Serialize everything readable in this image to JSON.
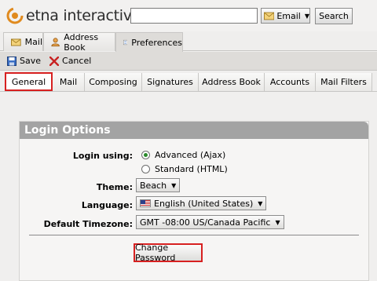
{
  "header": {
    "logo_text": "etna interactive",
    "search": {
      "value": "",
      "placeholder": ""
    },
    "email_dropdown": {
      "label": "Email",
      "icon": "envelope-icon"
    },
    "search_button": "Search"
  },
  "top_tabs": [
    {
      "label": "Mail",
      "icon": "envelope-icon",
      "active": false
    },
    {
      "label": "Address Book",
      "icon": "contacts-icon",
      "active": false
    },
    {
      "label": "Preferences",
      "icon": "preferences-icon",
      "active": true
    }
  ],
  "toolbar": {
    "save": "Save",
    "cancel": "Cancel"
  },
  "sub_tabs": [
    {
      "label": "General",
      "active": true
    },
    {
      "label": "Mail",
      "active": false
    },
    {
      "label": "Composing",
      "active": false
    },
    {
      "label": "Signatures",
      "active": false
    },
    {
      "label": "Address Book",
      "active": false
    },
    {
      "label": "Accounts",
      "active": false
    },
    {
      "label": "Mail Filters",
      "active": false
    }
  ],
  "login_options": {
    "title": "Login Options",
    "login_using_label": "Login using:",
    "login_options": [
      {
        "label": "Advanced (Ajax)",
        "selected": true
      },
      {
        "label": "Standard (HTML)",
        "selected": false
      }
    ],
    "theme_label": "Theme:",
    "theme_value": "Beach",
    "language_label": "Language:",
    "language_value": "English (United States)",
    "timezone_label": "Default Timezone:",
    "timezone_value": "GMT -08:00 US/Canada Pacific",
    "change_password": "Change Password"
  },
  "colors": {
    "highlight_red": "#d72020",
    "panel_header": "#a3a3a3",
    "radio_selected": "#2b8a2b"
  }
}
